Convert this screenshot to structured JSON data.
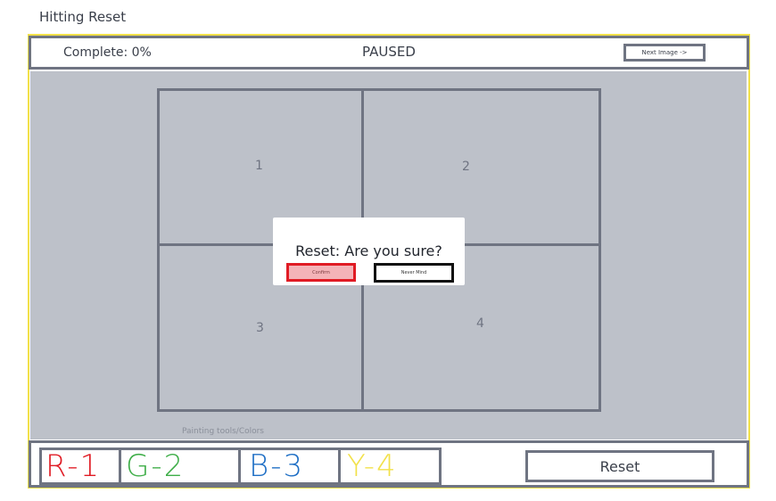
{
  "caption": "Hitting Reset",
  "header": {
    "complete_text": "Complete: 0%",
    "status_text": "PAUSED",
    "next_button_label": "Next Image ->"
  },
  "canvas": {
    "quadrants": [
      "1",
      "2",
      "3",
      "4"
    ]
  },
  "dialog": {
    "title": "Reset: Are you sure?",
    "confirm_label": "Confirm",
    "cancel_label": "Never Mind"
  },
  "tools": {
    "label": "Painting tools/Colors",
    "colors": [
      {
        "label": "R-1",
        "color": "#e01b24"
      },
      {
        "label": "G-2",
        "color": "#3fae49"
      },
      {
        "label": "B-3",
        "color": "#1f6fc5"
      },
      {
        "label": "Y-4",
        "color": "#f2e14a"
      }
    ]
  },
  "footer": {
    "reset_label": "Reset"
  }
}
